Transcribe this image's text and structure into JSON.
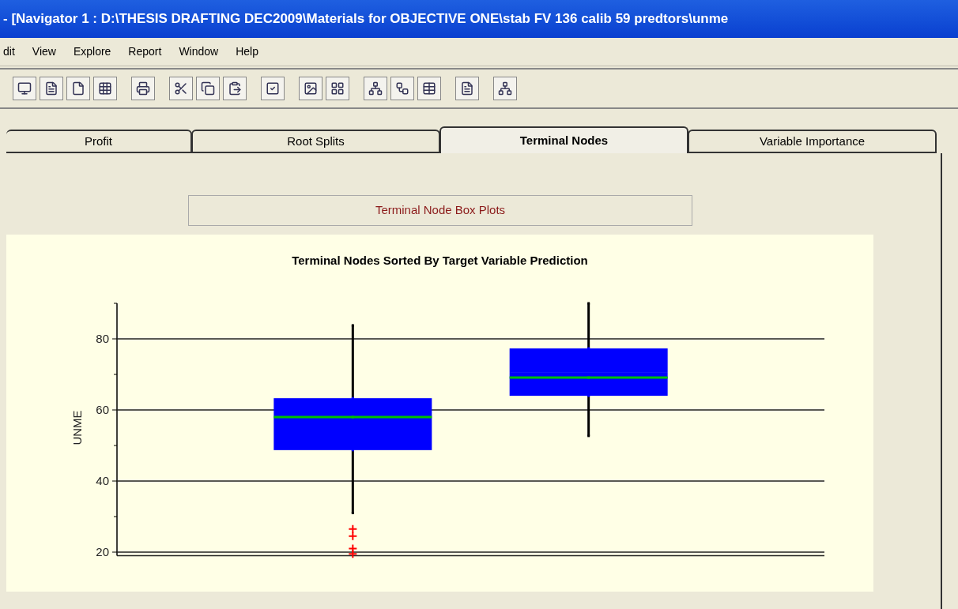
{
  "window": {
    "title": "- [Navigator 1  : D:\\THESIS DRAFTING DEC2009\\Materials for OBJECTIVE ONE\\stab FV 136 calib 59 predtors\\unme"
  },
  "menu": [
    "dit",
    "View",
    "Explore",
    "Report",
    "Window",
    "Help"
  ],
  "tabs": [
    {
      "label": "Profit",
      "selected": false
    },
    {
      "label": "Root Splits",
      "selected": false
    },
    {
      "label": "Terminal Nodes",
      "selected": true
    },
    {
      "label": "Variable Importance",
      "selected": false
    }
  ],
  "panel_header": "Terminal Node Box Plots",
  "chart": {
    "chart_data": {
      "type": "scatter",
      "title": "Terminal Nodes Sorted By Target Variable Prediction",
      "ylabel": "UNME",
      "categories": [
        null,
        null
      ],
      "ylim": [
        19,
        90
      ],
      "yticks": [
        20,
        40,
        60,
        80
      ],
      "grid": true,
      "series": [
        {
          "color": "#000000",
          "values": [
            31,
            52.7
          ]
        },
        {
          "color": "#0000ff",
          "values": [
            48.7,
            64
          ]
        },
        {
          "color": "#00c000",
          "values": [
            58,
            69.1
          ]
        },
        {
          "color": "#0000ff",
          "values": [
            63.3,
            77.3
          ]
        },
        {
          "color": "#000000",
          "values": [
            83.8,
            90
          ]
        },
        {
          "color": "#ff0000",
          "values": [
            26.5,
            null
          ]
        },
        {
          "color": "#ff0000",
          "values": [
            24.5,
            null
          ]
        },
        {
          "color": "#ff0000",
          "values": [
            21,
            null
          ]
        },
        {
          "color": "#ff0000",
          "values": [
            19.5,
            null
          ]
        }
      ]
    }
  }
}
